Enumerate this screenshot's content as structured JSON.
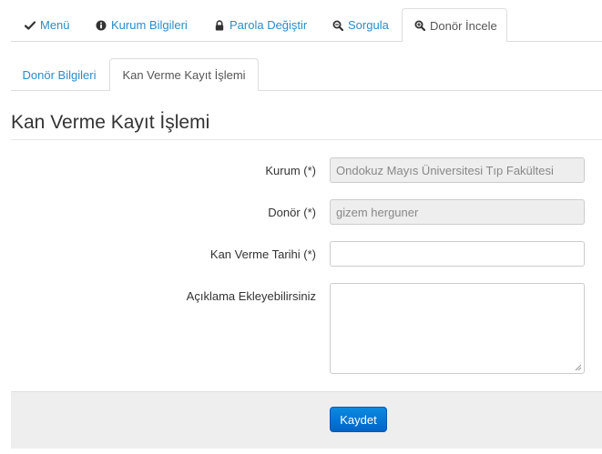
{
  "main_tabs": [
    {
      "label": "Menü",
      "icon": "check-icon",
      "active": false
    },
    {
      "label": "Kurum Bilgileri",
      "icon": "info-icon",
      "active": false
    },
    {
      "label": "Parola Değiştir",
      "icon": "lock-icon",
      "active": false
    },
    {
      "label": "Sorgula",
      "icon": "zoom-icon",
      "active": false
    },
    {
      "label": "Donör İncele",
      "icon": "zoom-icon",
      "active": true
    }
  ],
  "sub_tabs": [
    {
      "label": "Donör Bilgileri",
      "active": false
    },
    {
      "label": "Kan Verme Kayıt İşlemi",
      "active": true
    }
  ],
  "page": {
    "title": "Kan Verme Kayıt İşlemi"
  },
  "form": {
    "kurum": {
      "label": "Kurum (*)",
      "value": "Ondokuz Mayıs Üniversitesi Tıp Fakültesi"
    },
    "donor": {
      "label": "Donör (*)",
      "value": "gizem herguner"
    },
    "tarih": {
      "label": "Kan Verme Tarihi (*)",
      "value": ""
    },
    "aciklama": {
      "label": "Açıklama Ekleyebilirsiniz",
      "value": ""
    }
  },
  "actions": {
    "save_label": "Kaydet"
  },
  "colors": {
    "link": "#2a8dc8",
    "primary": "#0a79d9",
    "footer_bg": "#eeeeee"
  }
}
